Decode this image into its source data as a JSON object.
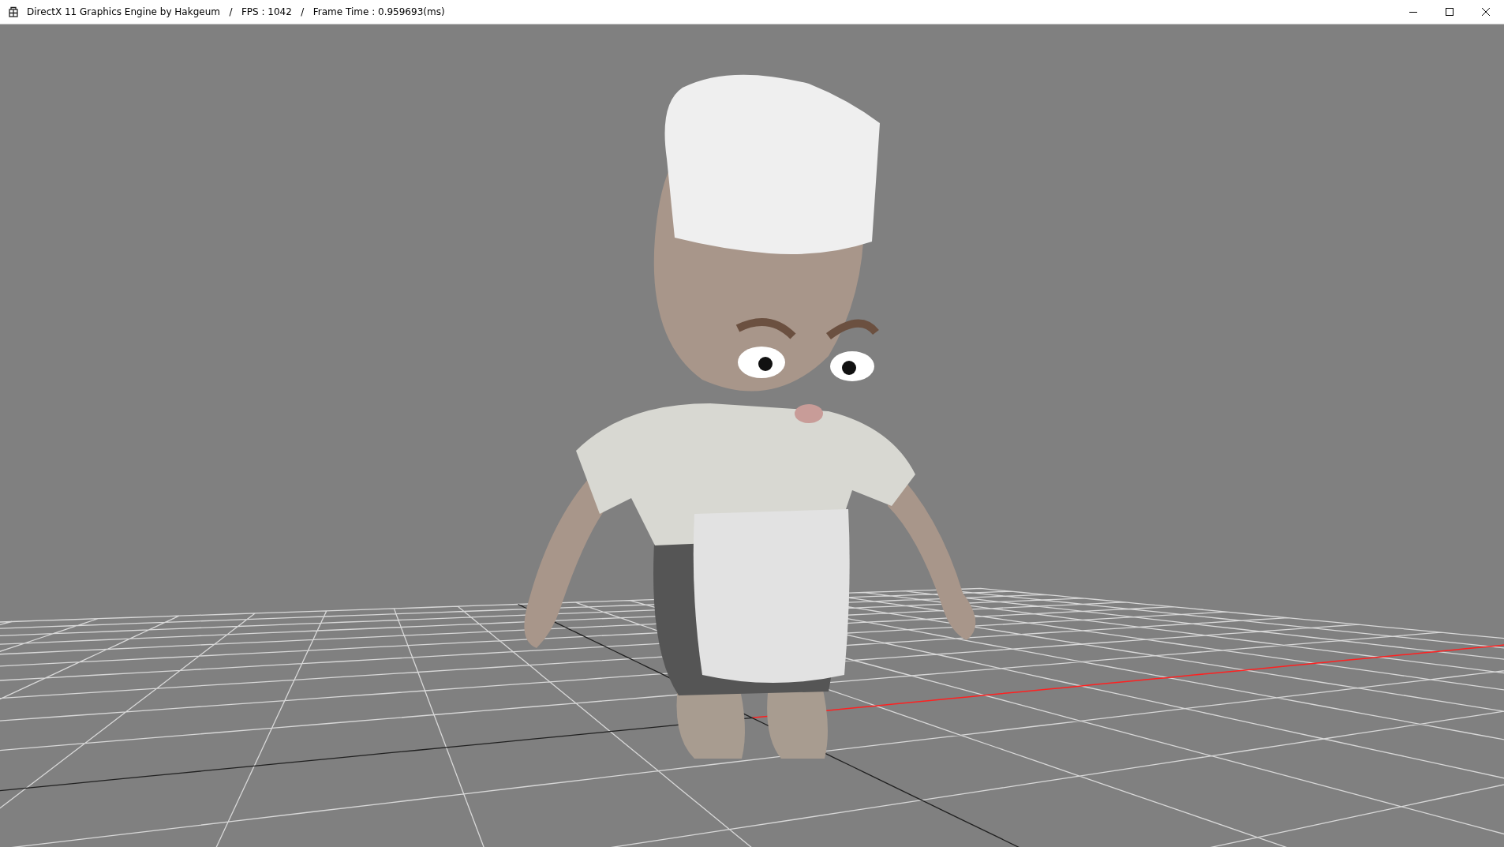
{
  "window": {
    "title": "DirectX 11 Graphics Engine by Hakgeum   /   FPS : 1042   /   Frame Time : 0.959693(ms)"
  }
}
